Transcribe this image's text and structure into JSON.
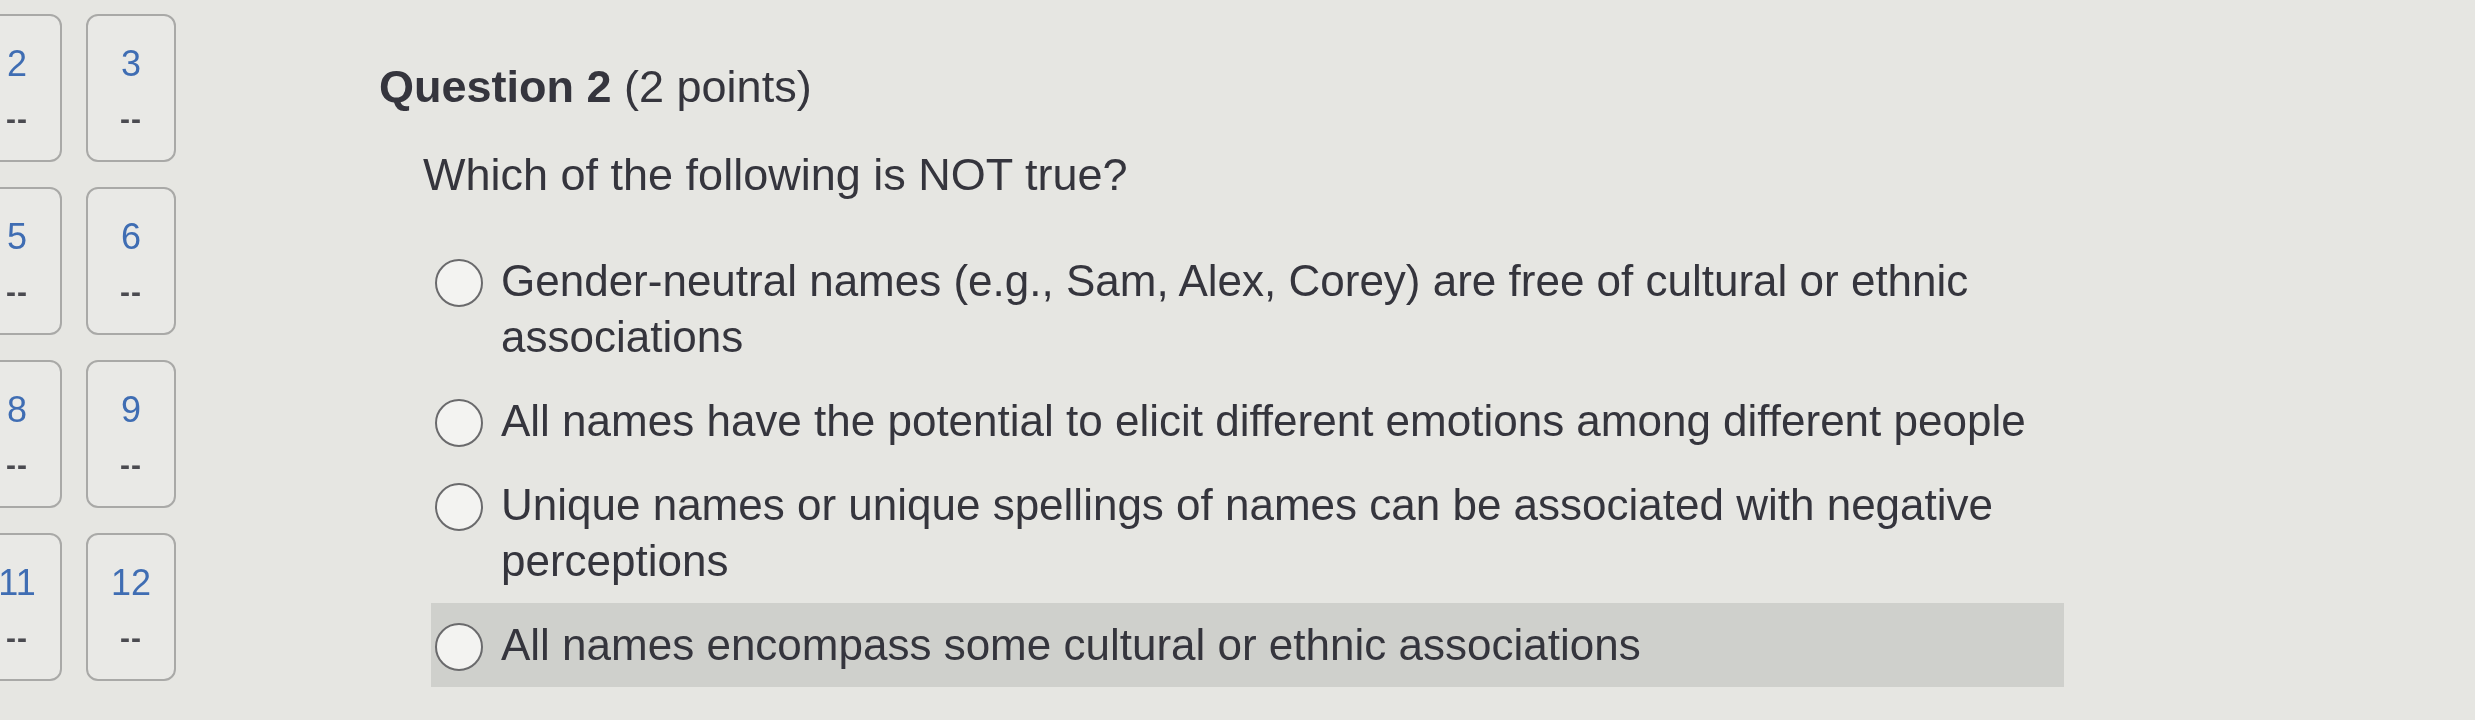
{
  "sidebar": {
    "question_tiles": [
      {
        "number": "2",
        "score": "--"
      },
      {
        "number": "3",
        "score": "--"
      },
      {
        "number": "5",
        "score": "--"
      },
      {
        "number": "6",
        "score": "--"
      },
      {
        "number": "8",
        "score": "--"
      },
      {
        "number": "9",
        "score": "--"
      },
      {
        "number": "11",
        "score": "--"
      },
      {
        "number": "12",
        "score": "--"
      }
    ]
  },
  "question": {
    "title": "**Question 2** (2 points)",
    "prompt": "Which of the following is NOT true?",
    "options": [
      {
        "text": "Gender-neutral names (e.g., Sam, Alex, Corey) are free of cultural or ethnic associations",
        "selected": false,
        "highlighted": false
      },
      {
        "text": "All names have the potential to elicit different emotions among different people",
        "selected": false,
        "highlighted": false
      },
      {
        "text": "Unique names or unique spellings of names can be associated with negative perceptions",
        "selected": false,
        "highlighted": false
      },
      {
        "text": "All names encompass some cultural or ethnic associations",
        "selected": false,
        "highlighted": true
      }
    ]
  }
}
